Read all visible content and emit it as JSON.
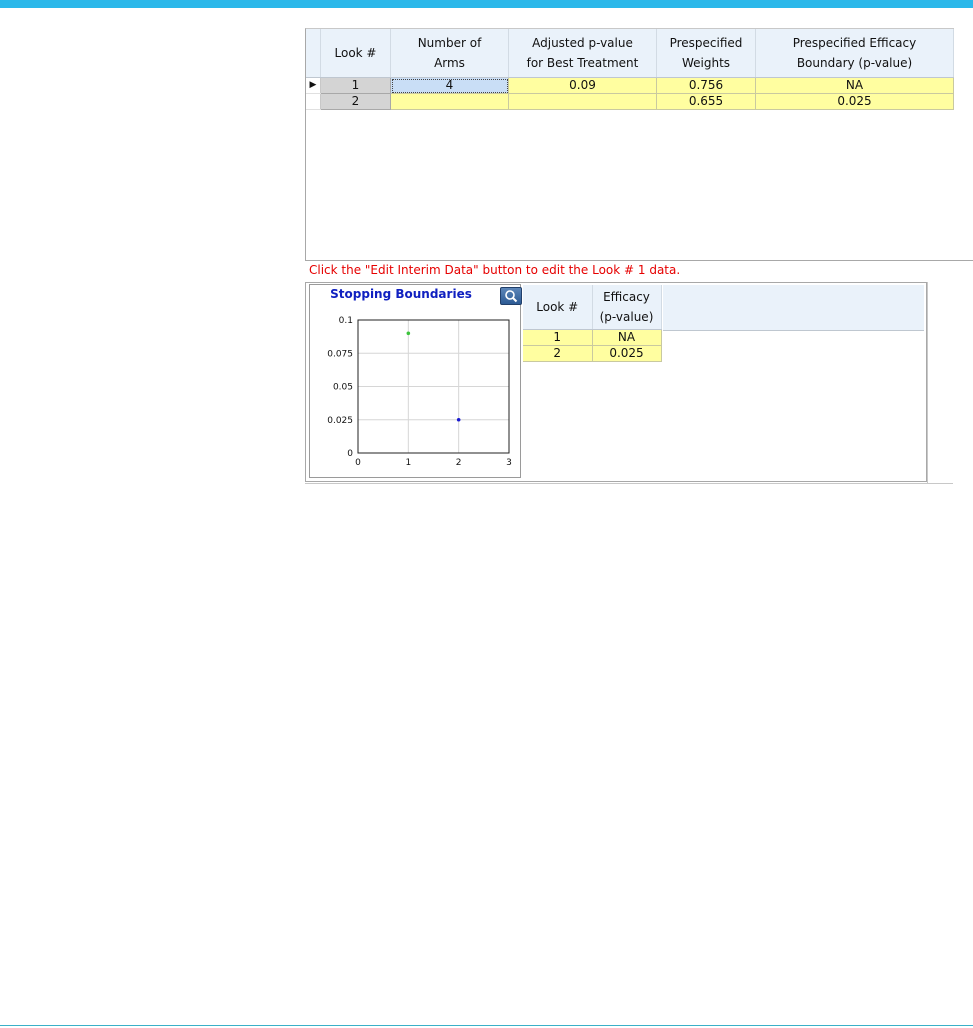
{
  "main_grid": {
    "columns": [
      "Look #",
      "Number of\nArms",
      "Adjusted p-value\nfor Best Treatment",
      "Prespecified\nWeights",
      "Prespecified Efficacy\nBoundary (p-value)"
    ],
    "current_row_marker": "▶",
    "rows": [
      {
        "look": "1",
        "arms": "4",
        "p_value": "0.09",
        "weights": "0.756",
        "boundary": "NA"
      },
      {
        "look": "2",
        "arms": "",
        "p_value": "",
        "weights": "0.655",
        "boundary": "0.025"
      }
    ]
  },
  "note": "Click the \"Edit Interim Data\" button to edit the Look # 1 data.",
  "chart": {
    "title": "Stopping Boundaries",
    "zoom_icon": "magnifier-icon",
    "colors": {
      "look1": "#3cc43c",
      "look2": "#1a1ad0"
    }
  },
  "chart_data": {
    "type": "scatter",
    "title": "Stopping Boundaries",
    "xlabel": "",
    "ylabel": "",
    "xlim": [
      0,
      3
    ],
    "ylim": [
      0,
      0.1
    ],
    "xticks": [
      "0",
      "1",
      "2",
      "3"
    ],
    "yticks": [
      "0",
      "0.025",
      "0.05",
      "0.075",
      "0.1"
    ],
    "grid": true,
    "points": [
      {
        "x": 1,
        "y": 0.09,
        "color": "#3cc43c"
      },
      {
        "x": 2,
        "y": 0.025,
        "color": "#1a1ad0"
      }
    ]
  },
  "efficacy_table": {
    "columns": [
      "Look #",
      "Efficacy\n(p-value)"
    ],
    "rows": [
      {
        "look": "1",
        "efficacy": "NA"
      },
      {
        "look": "2",
        "efficacy": "0.025"
      }
    ]
  }
}
